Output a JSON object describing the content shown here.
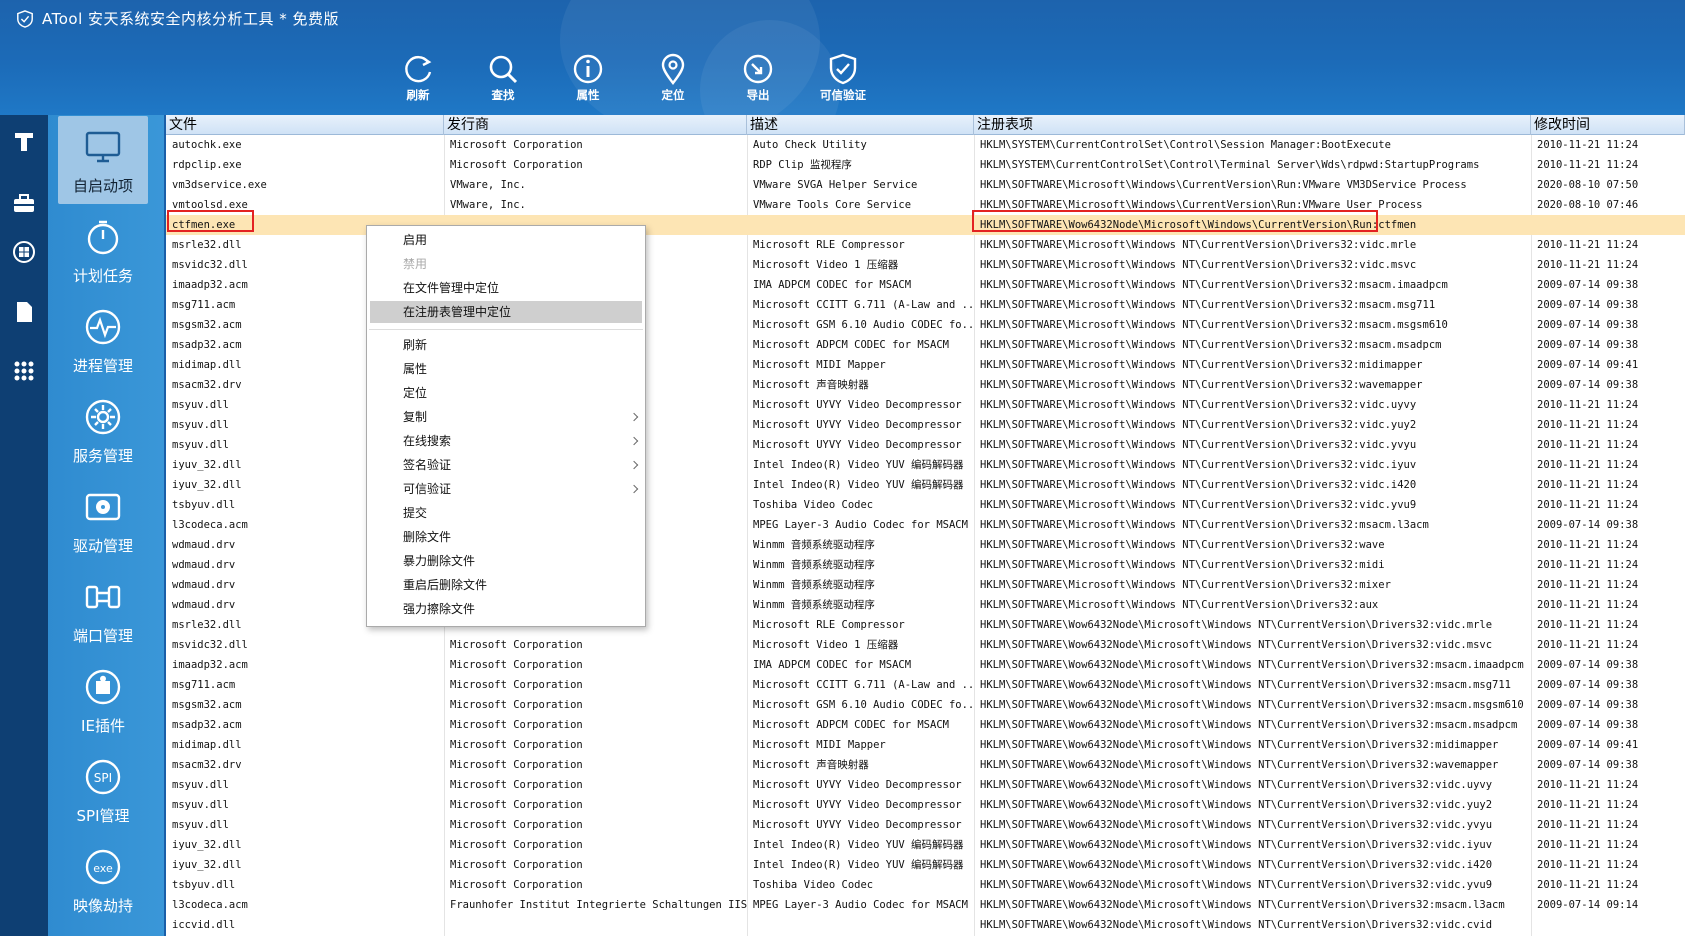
{
  "app": {
    "title": "ATool 安天系统安全内核分析工具 * 免费版"
  },
  "toolbar": [
    {
      "label": "刷新",
      "icon": "refresh-icon"
    },
    {
      "label": "查找",
      "icon": "search-icon"
    },
    {
      "label": "属性",
      "icon": "info-icon"
    },
    {
      "label": "定位",
      "icon": "location-icon"
    },
    {
      "label": "导出",
      "icon": "export-icon"
    },
    {
      "label": "可信验证",
      "icon": "shield-check-icon"
    }
  ],
  "rail": [
    "hammer-icon",
    "toolbox-icon",
    "windows-icon",
    "document-icon",
    "grid-icon"
  ],
  "nav": [
    {
      "label": "自启动项",
      "icon": "monitor-icon",
      "active": true
    },
    {
      "label": "计划任务",
      "icon": "timer-icon"
    },
    {
      "label": "进程管理",
      "icon": "pulse-icon"
    },
    {
      "label": "服务管理",
      "icon": "gear-icon"
    },
    {
      "label": "驱动管理",
      "icon": "drive-icon"
    },
    {
      "label": "端口管理",
      "icon": "plug-icon"
    },
    {
      "label": "IE插件",
      "icon": "puzzle-icon"
    },
    {
      "label": "SPI管理",
      "icon": "spi-icon"
    },
    {
      "label": "映像劫持",
      "icon": "exe-icon"
    }
  ],
  "columns": [
    "文件",
    "发行商",
    "描述",
    "注册表项",
    "修改时间"
  ],
  "rows": [
    [
      "autochk.exe",
      "Microsoft Corporation",
      "Auto Check Utility",
      "HKLM\\SYSTEM\\CurrentControlSet\\Control\\Session Manager:BootExecute",
      "2010-11-21 11:24"
    ],
    [
      "rdpclip.exe",
      "Microsoft Corporation",
      "RDP Clip 监视程序",
      "HKLM\\SYSTEM\\CurrentControlSet\\Control\\Terminal Server\\Wds\\rdpwd:StartupPrograms",
      "2010-11-21 11:24"
    ],
    [
      "vm3dservice.exe",
      "VMware, Inc.",
      "VMware SVGA Helper Service",
      "HKLM\\SOFTWARE\\Microsoft\\Windows\\CurrentVersion\\Run:VMware VM3DService Process",
      "2020-08-10 07:50"
    ],
    [
      "vmtoolsd.exe",
      "VMware, Inc.",
      "VMware Tools Core Service",
      "HKLM\\SOFTWARE\\Microsoft\\Windows\\CurrentVersion\\Run:VMware User Process",
      "2020-08-10 07:46"
    ],
    [
      "ctfmen.exe",
      "",
      "",
      "HKLM\\SOFTWARE\\Wow6432Node\\Microsoft\\Windows\\CurrentVersion\\Run:ctfmen",
      ""
    ],
    [
      "msrle32.dll",
      "",
      "Microsoft RLE Compressor",
      "HKLM\\SOFTWARE\\Microsoft\\Windows NT\\CurrentVersion\\Drivers32:vidc.mrle",
      "2010-11-21 11:24"
    ],
    [
      "msvidc32.dll",
      "",
      "Microsoft Video 1 压缩器",
      "HKLM\\SOFTWARE\\Microsoft\\Windows NT\\CurrentVersion\\Drivers32:vidc.msvc",
      "2010-11-21 11:24"
    ],
    [
      "imaadp32.acm",
      "",
      "IMA ADPCM CODEC for MSACM",
      "HKLM\\SOFTWARE\\Microsoft\\Windows NT\\CurrentVersion\\Drivers32:msacm.imaadpcm",
      "2009-07-14 09:38"
    ],
    [
      "msg711.acm",
      "",
      "Microsoft CCITT G.711 (A-Law and ...",
      "HKLM\\SOFTWARE\\Microsoft\\Windows NT\\CurrentVersion\\Drivers32:msacm.msg711",
      "2009-07-14 09:38"
    ],
    [
      "msgsm32.acm",
      "",
      "Microsoft GSM 6.10 Audio CODEC fo...",
      "HKLM\\SOFTWARE\\Microsoft\\Windows NT\\CurrentVersion\\Drivers32:msacm.msgsm610",
      "2009-07-14 09:38"
    ],
    [
      "msadp32.acm",
      "",
      "Microsoft ADPCM CODEC for MSACM",
      "HKLM\\SOFTWARE\\Microsoft\\Windows NT\\CurrentVersion\\Drivers32:msacm.msadpcm",
      "2009-07-14 09:38"
    ],
    [
      "midimap.dll",
      "",
      "Microsoft MIDI Mapper",
      "HKLM\\SOFTWARE\\Microsoft\\Windows NT\\CurrentVersion\\Drivers32:midimapper",
      "2009-07-14 09:41"
    ],
    [
      "msacm32.drv",
      "",
      "Microsoft 声音映射器",
      "HKLM\\SOFTWARE\\Microsoft\\Windows NT\\CurrentVersion\\Drivers32:wavemapper",
      "2009-07-14 09:38"
    ],
    [
      "msyuv.dll",
      "",
      "Microsoft UYVY Video Decompressor",
      "HKLM\\SOFTWARE\\Microsoft\\Windows NT\\CurrentVersion\\Drivers32:vidc.uyvy",
      "2010-11-21 11:24"
    ],
    [
      "msyuv.dll",
      "",
      "Microsoft UYVY Video Decompressor",
      "HKLM\\SOFTWARE\\Microsoft\\Windows NT\\CurrentVersion\\Drivers32:vidc.yuy2",
      "2010-11-21 11:24"
    ],
    [
      "msyuv.dll",
      "",
      "Microsoft UYVY Video Decompressor",
      "HKLM\\SOFTWARE\\Microsoft\\Windows NT\\CurrentVersion\\Drivers32:vidc.yvyu",
      "2010-11-21 11:24"
    ],
    [
      "iyuv_32.dll",
      "",
      "Intel Indeo(R) Video YUV 编码解码器",
      "HKLM\\SOFTWARE\\Microsoft\\Windows NT\\CurrentVersion\\Drivers32:vidc.iyuv",
      "2010-11-21 11:24"
    ],
    [
      "iyuv_32.dll",
      "",
      "Intel Indeo(R) Video YUV 编码解码器",
      "HKLM\\SOFTWARE\\Microsoft\\Windows NT\\CurrentVersion\\Drivers32:vidc.i420",
      "2010-11-21 11:24"
    ],
    [
      "tsbyuv.dll",
      "",
      "Toshiba Video Codec",
      "HKLM\\SOFTWARE\\Microsoft\\Windows NT\\CurrentVersion\\Drivers32:vidc.yvu9",
      "2010-11-21 11:24"
    ],
    [
      "l3codeca.acm",
      "chaltungen IIS",
      "MPEG Layer-3 Audio Codec for MSACM",
      "HKLM\\SOFTWARE\\Microsoft\\Windows NT\\CurrentVersion\\Drivers32:msacm.l3acm",
      "2009-07-14 09:38"
    ],
    [
      "wdmaud.drv",
      "",
      "Winmm 音频系统驱动程序",
      "HKLM\\SOFTWARE\\Microsoft\\Windows NT\\CurrentVersion\\Drivers32:wave",
      "2010-11-21 11:24"
    ],
    [
      "wdmaud.drv",
      "",
      "Winmm 音频系统驱动程序",
      "HKLM\\SOFTWARE\\Microsoft\\Windows NT\\CurrentVersion\\Drivers32:midi",
      "2010-11-21 11:24"
    ],
    [
      "wdmaud.drv",
      "",
      "Winmm 音频系统驱动程序",
      "HKLM\\SOFTWARE\\Microsoft\\Windows NT\\CurrentVersion\\Drivers32:mixer",
      "2010-11-21 11:24"
    ],
    [
      "wdmaud.drv",
      "",
      "Winmm 音频系统驱动程序",
      "HKLM\\SOFTWARE\\Microsoft\\Windows NT\\CurrentVersion\\Drivers32:aux",
      "2010-11-21 11:24"
    ],
    [
      "msrle32.dll",
      "",
      "Microsoft RLE Compressor",
      "HKLM\\SOFTWARE\\Wow6432Node\\Microsoft\\Windows NT\\CurrentVersion\\Drivers32:vidc.mrle",
      "2010-11-21 11:24"
    ],
    [
      "msvidc32.dll",
      "Microsoft Corporation",
      "Microsoft Video 1 压缩器",
      "HKLM\\SOFTWARE\\Wow6432Node\\Microsoft\\Windows NT\\CurrentVersion\\Drivers32:vidc.msvc",
      "2010-11-21 11:24"
    ],
    [
      "imaadp32.acm",
      "Microsoft Corporation",
      "IMA ADPCM CODEC for MSACM",
      "HKLM\\SOFTWARE\\Wow6432Node\\Microsoft\\Windows NT\\CurrentVersion\\Drivers32:msacm.imaadpcm",
      "2009-07-14 09:38"
    ],
    [
      "msg711.acm",
      "Microsoft Corporation",
      "Microsoft CCITT G.711 (A-Law and ...",
      "HKLM\\SOFTWARE\\Wow6432Node\\Microsoft\\Windows NT\\CurrentVersion\\Drivers32:msacm.msg711",
      "2009-07-14 09:38"
    ],
    [
      "msgsm32.acm",
      "Microsoft Corporation",
      "Microsoft GSM 6.10 Audio CODEC fo...",
      "HKLM\\SOFTWARE\\Wow6432Node\\Microsoft\\Windows NT\\CurrentVersion\\Drivers32:msacm.msgsm610",
      "2009-07-14 09:38"
    ],
    [
      "msadp32.acm",
      "Microsoft Corporation",
      "Microsoft ADPCM CODEC for MSACM",
      "HKLM\\SOFTWARE\\Wow6432Node\\Microsoft\\Windows NT\\CurrentVersion\\Drivers32:msacm.msadpcm",
      "2009-07-14 09:38"
    ],
    [
      "midimap.dll",
      "Microsoft Corporation",
      "Microsoft MIDI Mapper",
      "HKLM\\SOFTWARE\\Wow6432Node\\Microsoft\\Windows NT\\CurrentVersion\\Drivers32:midimapper",
      "2009-07-14 09:41"
    ],
    [
      "msacm32.drv",
      "Microsoft Corporation",
      "Microsoft 声音映射器",
      "HKLM\\SOFTWARE\\Wow6432Node\\Microsoft\\Windows NT\\CurrentVersion\\Drivers32:wavemapper",
      "2009-07-14 09:38"
    ],
    [
      "msyuv.dll",
      "Microsoft Corporation",
      "Microsoft UYVY Video Decompressor",
      "HKLM\\SOFTWARE\\Wow6432Node\\Microsoft\\Windows NT\\CurrentVersion\\Drivers32:vidc.uyvy",
      "2010-11-21 11:24"
    ],
    [
      "msyuv.dll",
      "Microsoft Corporation",
      "Microsoft UYVY Video Decompressor",
      "HKLM\\SOFTWARE\\Wow6432Node\\Microsoft\\Windows NT\\CurrentVersion\\Drivers32:vidc.yuy2",
      "2010-11-21 11:24"
    ],
    [
      "msyuv.dll",
      "Microsoft Corporation",
      "Microsoft UYVY Video Decompressor",
      "HKLM\\SOFTWARE\\Wow6432Node\\Microsoft\\Windows NT\\CurrentVersion\\Drivers32:vidc.yvyu",
      "2010-11-21 11:24"
    ],
    [
      "iyuv_32.dll",
      "Microsoft Corporation",
      "Intel Indeo(R) Video YUV 编码解码器",
      "HKLM\\SOFTWARE\\Wow6432Node\\Microsoft\\Windows NT\\CurrentVersion\\Drivers32:vidc.iyuv",
      "2010-11-21 11:24"
    ],
    [
      "iyuv_32.dll",
      "Microsoft Corporation",
      "Intel Indeo(R) Video YUV 编码解码器",
      "HKLM\\SOFTWARE\\Wow6432Node\\Microsoft\\Windows NT\\CurrentVersion\\Drivers32:vidc.i420",
      "2010-11-21 11:24"
    ],
    [
      "tsbyuv.dll",
      "Microsoft Corporation",
      "Toshiba Video Codec",
      "HKLM\\SOFTWARE\\Wow6432Node\\Microsoft\\Windows NT\\CurrentVersion\\Drivers32:vidc.yvu9",
      "2010-11-21 11:24"
    ],
    [
      "l3codeca.acm",
      "Fraunhofer Institut Integrierte Schaltungen IIS",
      "MPEG Layer-3 Audio Codec for MSACM",
      "HKLM\\SOFTWARE\\Wow6432Node\\Microsoft\\Windows NT\\CurrentVersion\\Drivers32:msacm.l3acm",
      "2009-07-14 09:14"
    ],
    [
      "iccvid.dll",
      "",
      "",
      "HKLM\\SOFTWARE\\Wow6432Node\\Microsoft\\Windows NT\\CurrentVersion\\Drivers32:vidc.cvid",
      ""
    ]
  ],
  "selected_row": 4,
  "context_menu": [
    {
      "label": "启用"
    },
    {
      "label": "禁用",
      "disabled": true
    },
    {
      "label": "在文件管理中定位"
    },
    {
      "label": "在注册表管理中定位",
      "hover": true
    },
    {
      "separator": true
    },
    {
      "label": "刷新"
    },
    {
      "label": "属性"
    },
    {
      "label": "定位"
    },
    {
      "label": "复制",
      "submenu": true
    },
    {
      "label": "在线搜索",
      "submenu": true
    },
    {
      "label": "签名验证",
      "submenu": true
    },
    {
      "label": "可信验证",
      "submenu": true
    },
    {
      "label": "提交"
    },
    {
      "label": "删除文件"
    },
    {
      "label": "暴力删除文件"
    },
    {
      "label": "重启后删除文件"
    },
    {
      "label": "强力擦除文件"
    }
  ],
  "colors": {
    "accent": "#1d63ad",
    "nav": "#3a97d8",
    "selected_row": "#fde5b4",
    "highlight": "#e32222"
  }
}
